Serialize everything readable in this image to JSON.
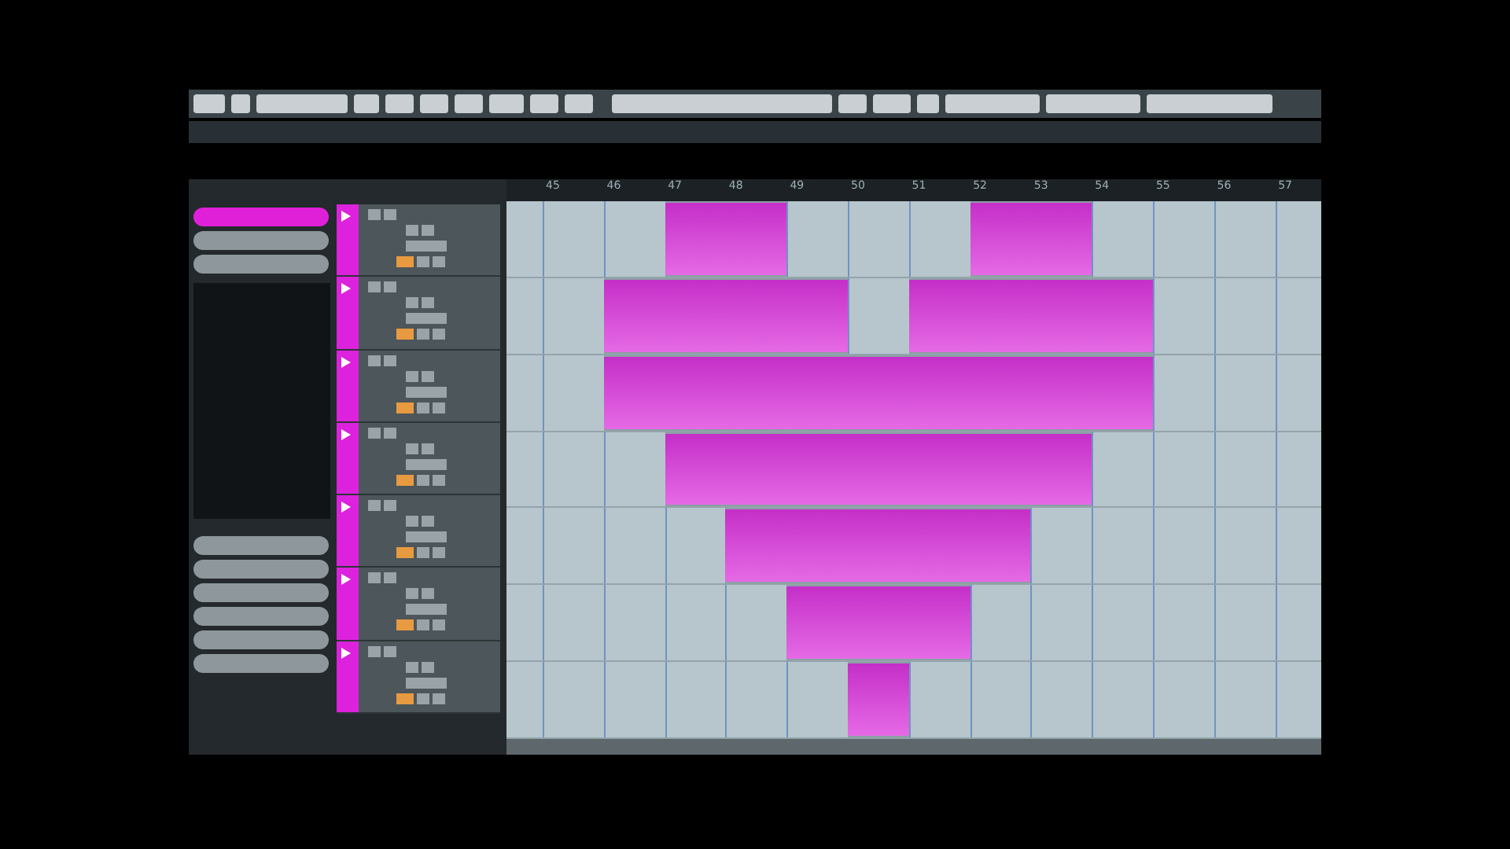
{
  "ruler": {
    "labels": [
      "45",
      "46",
      "47",
      "48",
      "49",
      "50",
      "51",
      "52",
      "53",
      "54",
      "55",
      "56",
      "57"
    ]
  },
  "inspector": {
    "top_items": [
      {
        "selected": true
      },
      {
        "selected": false
      },
      {
        "selected": false
      }
    ],
    "bottom_items": [
      {
        "selected": false
      },
      {
        "selected": false
      },
      {
        "selected": false
      },
      {
        "selected": false
      },
      {
        "selected": false
      },
      {
        "selected": false
      }
    ]
  },
  "tracks": [
    {
      "filled": [
        false,
        false,
        true,
        true,
        false,
        false,
        false,
        true,
        true,
        false,
        false,
        false,
        false
      ]
    },
    {
      "filled": [
        false,
        true,
        true,
        true,
        true,
        false,
        true,
        true,
        true,
        true,
        false,
        false,
        false
      ]
    },
    {
      "filled": [
        false,
        true,
        true,
        true,
        true,
        true,
        true,
        true,
        true,
        true,
        false,
        false,
        false
      ]
    },
    {
      "filled": [
        false,
        false,
        true,
        true,
        true,
        true,
        true,
        true,
        true,
        false,
        false,
        false,
        false
      ]
    },
    {
      "filled": [
        false,
        false,
        false,
        true,
        true,
        true,
        true,
        true,
        false,
        false,
        false,
        false,
        false
      ]
    },
    {
      "filled": [
        false,
        false,
        false,
        false,
        true,
        true,
        true,
        false,
        false,
        false,
        false,
        false,
        false
      ]
    },
    {
      "filled": [
        false,
        false,
        false,
        false,
        false,
        true,
        false,
        false,
        false,
        false,
        false,
        false,
        false
      ]
    }
  ]
}
